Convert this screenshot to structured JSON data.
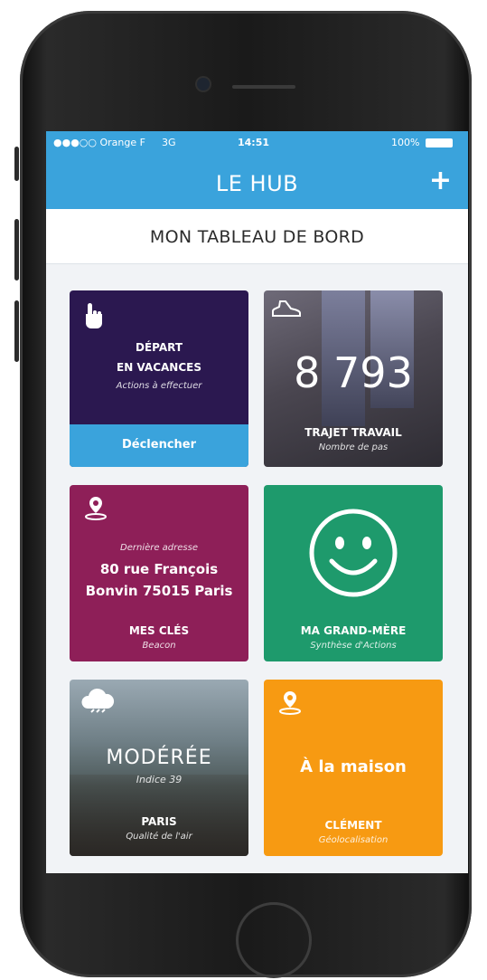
{
  "status_bar": {
    "carrier": "●●●○○ Orange F",
    "network": "3G",
    "time": "14:51",
    "battery": "100%"
  },
  "header": {
    "title": "LE HUB",
    "add_label": "+"
  },
  "subheader": {
    "title": "MON TABLEAU DE BORD"
  },
  "tiles": {
    "vacation": {
      "title_line1": "DÉPART",
      "title_line2": "EN VACANCES",
      "subtitle": "Actions à effectuer",
      "action_label": "Déclencher",
      "color": "#2b1850",
      "action_color": "#3aa3dc",
      "icon": "hand-pointer-icon"
    },
    "commute": {
      "value": "8 793",
      "label": "TRAJET TRAVAIL",
      "sublabel": "Nombre de pas",
      "icon": "shoe-icon"
    },
    "keys": {
      "caption": "Dernière adresse",
      "address_line1": "80 rue François",
      "address_line2": "Bonvin 75015 Paris",
      "label": "MES CLÉS",
      "sublabel": "Beacon",
      "color": "#8e1f58",
      "icon": "location-pin-icon"
    },
    "grandmother": {
      "label": "MA GRAND-MÈRE",
      "sublabel": "Synthèse d'Actions",
      "color": "#1e9a6c",
      "icon": "smiley-icon"
    },
    "air": {
      "value": "MODÉRÉE",
      "caption": "Indice 39",
      "label": "PARIS",
      "sublabel": "Qualité de l'air",
      "icon": "cloud-icon"
    },
    "home": {
      "value": "À la maison",
      "label": "CLÉMENT",
      "sublabel": "Géolocalisation",
      "color": "#f79a12",
      "icon": "location-pin-icon"
    }
  },
  "colors": {
    "accent": "#3aa3dc",
    "background": "#f1f3f6"
  }
}
